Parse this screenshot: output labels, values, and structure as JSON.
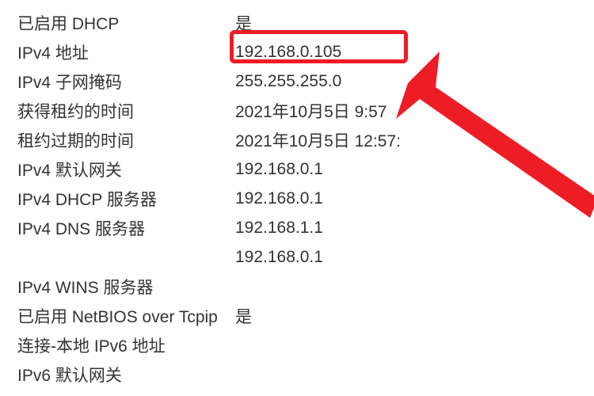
{
  "rows": [
    {
      "label": "已启用 DHCP",
      "value": "是"
    },
    {
      "label": "IPv4 地址",
      "value": "192.168.0.105"
    },
    {
      "label": "IPv4 子网掩码",
      "value": "255.255.255.0"
    },
    {
      "label": "获得租约的时间",
      "value": "2021年10月5日 9:57"
    },
    {
      "label": "租约过期的时间",
      "value": "2021年10月5日 12:57:"
    },
    {
      "label": "IPv4 默认网关",
      "value": "192.168.0.1"
    },
    {
      "label": "IPv4 DHCP 服务器",
      "value": "192.168.0.1"
    },
    {
      "label": "IPv4 DNS 服务器",
      "value": "192.168.1.1"
    },
    {
      "label": "",
      "value": "192.168.0.1"
    },
    {
      "label": "IPv4 WINS 服务器",
      "value": ""
    },
    {
      "label": "已启用 NetBIOS over Tcpip",
      "value": "是"
    },
    {
      "label": "连接-本地 IPv6 地址",
      "value": ""
    },
    {
      "label": "IPv6 默认网关",
      "value": ""
    }
  ]
}
